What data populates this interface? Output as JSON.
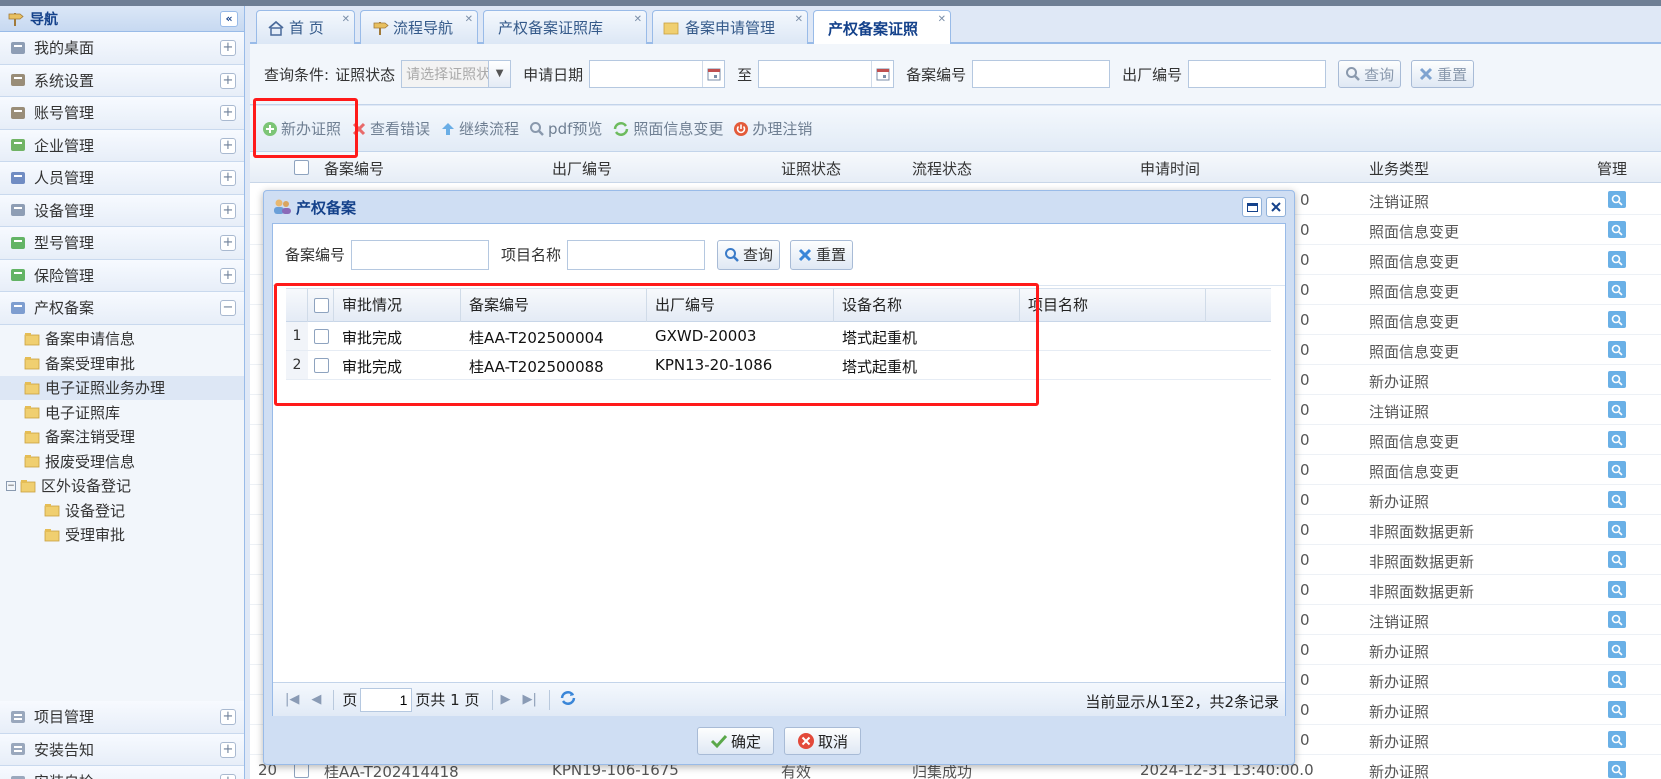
{
  "nav": {
    "title": "导航",
    "collapse": "«",
    "sections": [
      {
        "label": "我的桌面",
        "toggle": "+"
      },
      {
        "label": "系统设置",
        "toggle": "+"
      },
      {
        "label": "账号管理",
        "toggle": "+"
      },
      {
        "label": "企业管理",
        "toggle": "+"
      },
      {
        "label": "人员管理",
        "toggle": "+"
      },
      {
        "label": "设备管理",
        "toggle": "+"
      },
      {
        "label": "型号管理",
        "toggle": "+"
      },
      {
        "label": "保险管理",
        "toggle": "+"
      },
      {
        "label": "产权备案",
        "toggle": "−"
      }
    ],
    "tree": [
      {
        "label": "备案申请信息",
        "indent": 1
      },
      {
        "label": "备案受理审批",
        "indent": 1
      },
      {
        "label": "电子证照业务办理",
        "indent": 1,
        "selected": true
      },
      {
        "label": "电子证照库",
        "indent": 1
      },
      {
        "label": "备案注销受理",
        "indent": 1
      },
      {
        "label": "报废受理信息",
        "indent": 1
      },
      {
        "label": "区外设备登记",
        "indent": 0
      },
      {
        "label": "设备登记",
        "indent": 2
      },
      {
        "label": "受理审批",
        "indent": 2
      }
    ],
    "bottom_sections": [
      {
        "label": "项目管理",
        "toggle": "+"
      },
      {
        "label": "安装告知",
        "toggle": "+"
      },
      {
        "label": "安装自检",
        "toggle": "+"
      }
    ]
  },
  "tabs": [
    {
      "label": "首 页"
    },
    {
      "label": "流程导航"
    },
    {
      "label": "产权备案证照库"
    },
    {
      "label": "备案申请管理"
    },
    {
      "label": "产权备案证照"
    }
  ],
  "query": {
    "prefix": "查询条件:",
    "status_label": "证照状态",
    "status_placeholder": "请选择证照状态",
    "date_label": "申请日期",
    "to": "至",
    "record_label": "备案编号",
    "factory_label": "出厂编号",
    "search": "查询",
    "reset": "重置"
  },
  "toolbar": {
    "new": "新办证照",
    "errors": "查看错误",
    "continue": "继续流程",
    "pdf": "pdf预览",
    "change": "照面信息变更",
    "cancel": "办理注销"
  },
  "bg_grid": {
    "headers": [
      "备案编号",
      "出厂编号",
      "证照状态",
      "流程状态",
      "申请时间",
      "业务类型",
      "管理"
    ],
    "types": [
      "注销证照",
      "照面信息变更",
      "照面信息变更",
      "照面信息变更",
      "照面信息变更",
      "照面信息变更",
      "新办证照",
      "注销证照",
      "照面信息变更",
      "照面信息变更",
      "新办证照",
      "非照面数据更新",
      "非照面数据更新",
      "非照面数据更新",
      "注销证照",
      "新办证照",
      "新办证照",
      "新办证照",
      "新办证照",
      "新办证照"
    ],
    "last_row": {
      "num": "20",
      "record": "桂AA-T202414418",
      "factory": "KPN19-106-1675",
      "status": "有效",
      "flow": "归集成功",
      "time": "2024-12-31 13:40:00.0"
    }
  },
  "modal": {
    "title": "产权备案",
    "search": {
      "record_label": "备案编号",
      "project_label": "项目名称",
      "query": "查询",
      "reset": "重置"
    },
    "headers": [
      "审批情况",
      "备案编号",
      "出厂编号",
      "设备名称",
      "项目名称"
    ],
    "rows": [
      {
        "num": "1",
        "approval": "审批完成",
        "record": "桂AA-T202500004",
        "factory": "GXWD-20003",
        "device": "塔式起重机",
        "project": ""
      },
      {
        "num": "2",
        "approval": "审批完成",
        "record": "桂AA-T202500088",
        "factory": "KPN13-20-1086",
        "device": "塔式起重机",
        "project": ""
      }
    ],
    "pager": {
      "page_label": "页",
      "page_value": "1",
      "total": "页共 1 页",
      "info": "当前显示从1至2，共2条记录"
    },
    "ok": "确定",
    "cancel": "取消"
  }
}
